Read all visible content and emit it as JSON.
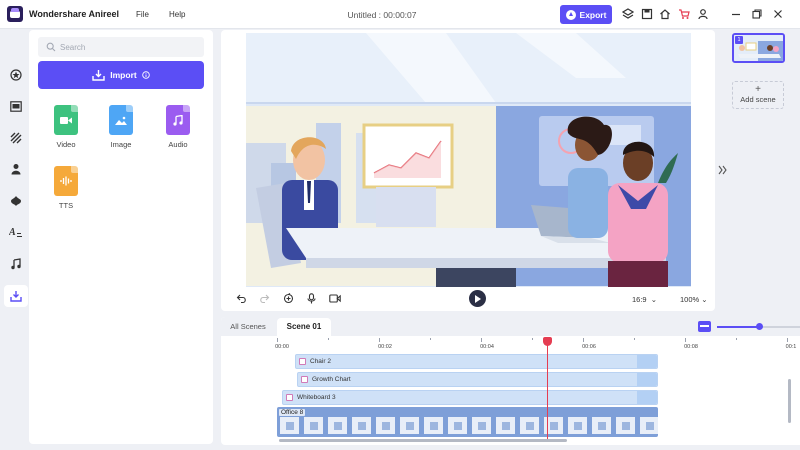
{
  "app": {
    "name": "Wondershare Anireel",
    "doc_title": "Untitled : 00:00:07"
  },
  "menu": [
    "File",
    "Help"
  ],
  "toolbar": {
    "export_label": "Export"
  },
  "colors": {
    "accent": "#5b4ef5",
    "playhead": "#e53d52",
    "track": "#cfe1f7"
  },
  "rail": [
    "character-icon",
    "scene-icon",
    "props-icon",
    "people-icon",
    "effects-icon",
    "text-icon",
    "music-icon",
    "import-media-icon"
  ],
  "media": {
    "search_placeholder": "Search",
    "import_label": "Import",
    "tiles": [
      {
        "label": "Video",
        "color": "#3dc27f",
        "icon": "video-icon"
      },
      {
        "label": "Image",
        "color": "#4ea6f5",
        "icon": "image-icon"
      },
      {
        "label": "Audio",
        "color": "#9b5cf0",
        "icon": "audio-icon"
      },
      {
        "label": "TTS",
        "color": "#f5a93a",
        "icon": "tts-icon"
      }
    ]
  },
  "preview": {
    "aspect_ratio": "16:9",
    "zoom": "100%"
  },
  "scenes": {
    "add_label": "Add scene",
    "thumb_number": "1"
  },
  "timeline": {
    "tabs": [
      "All Scenes",
      "Scene 01"
    ],
    "zoom_level": 0.5,
    "ruler": [
      "00:00",
      "00:02",
      "00:04",
      "00:06",
      "00:08",
      "00:1"
    ],
    "tracks": [
      "Chair 2",
      "Growth Chart",
      "Whiteboard 3"
    ],
    "background_track": "Office 8"
  }
}
